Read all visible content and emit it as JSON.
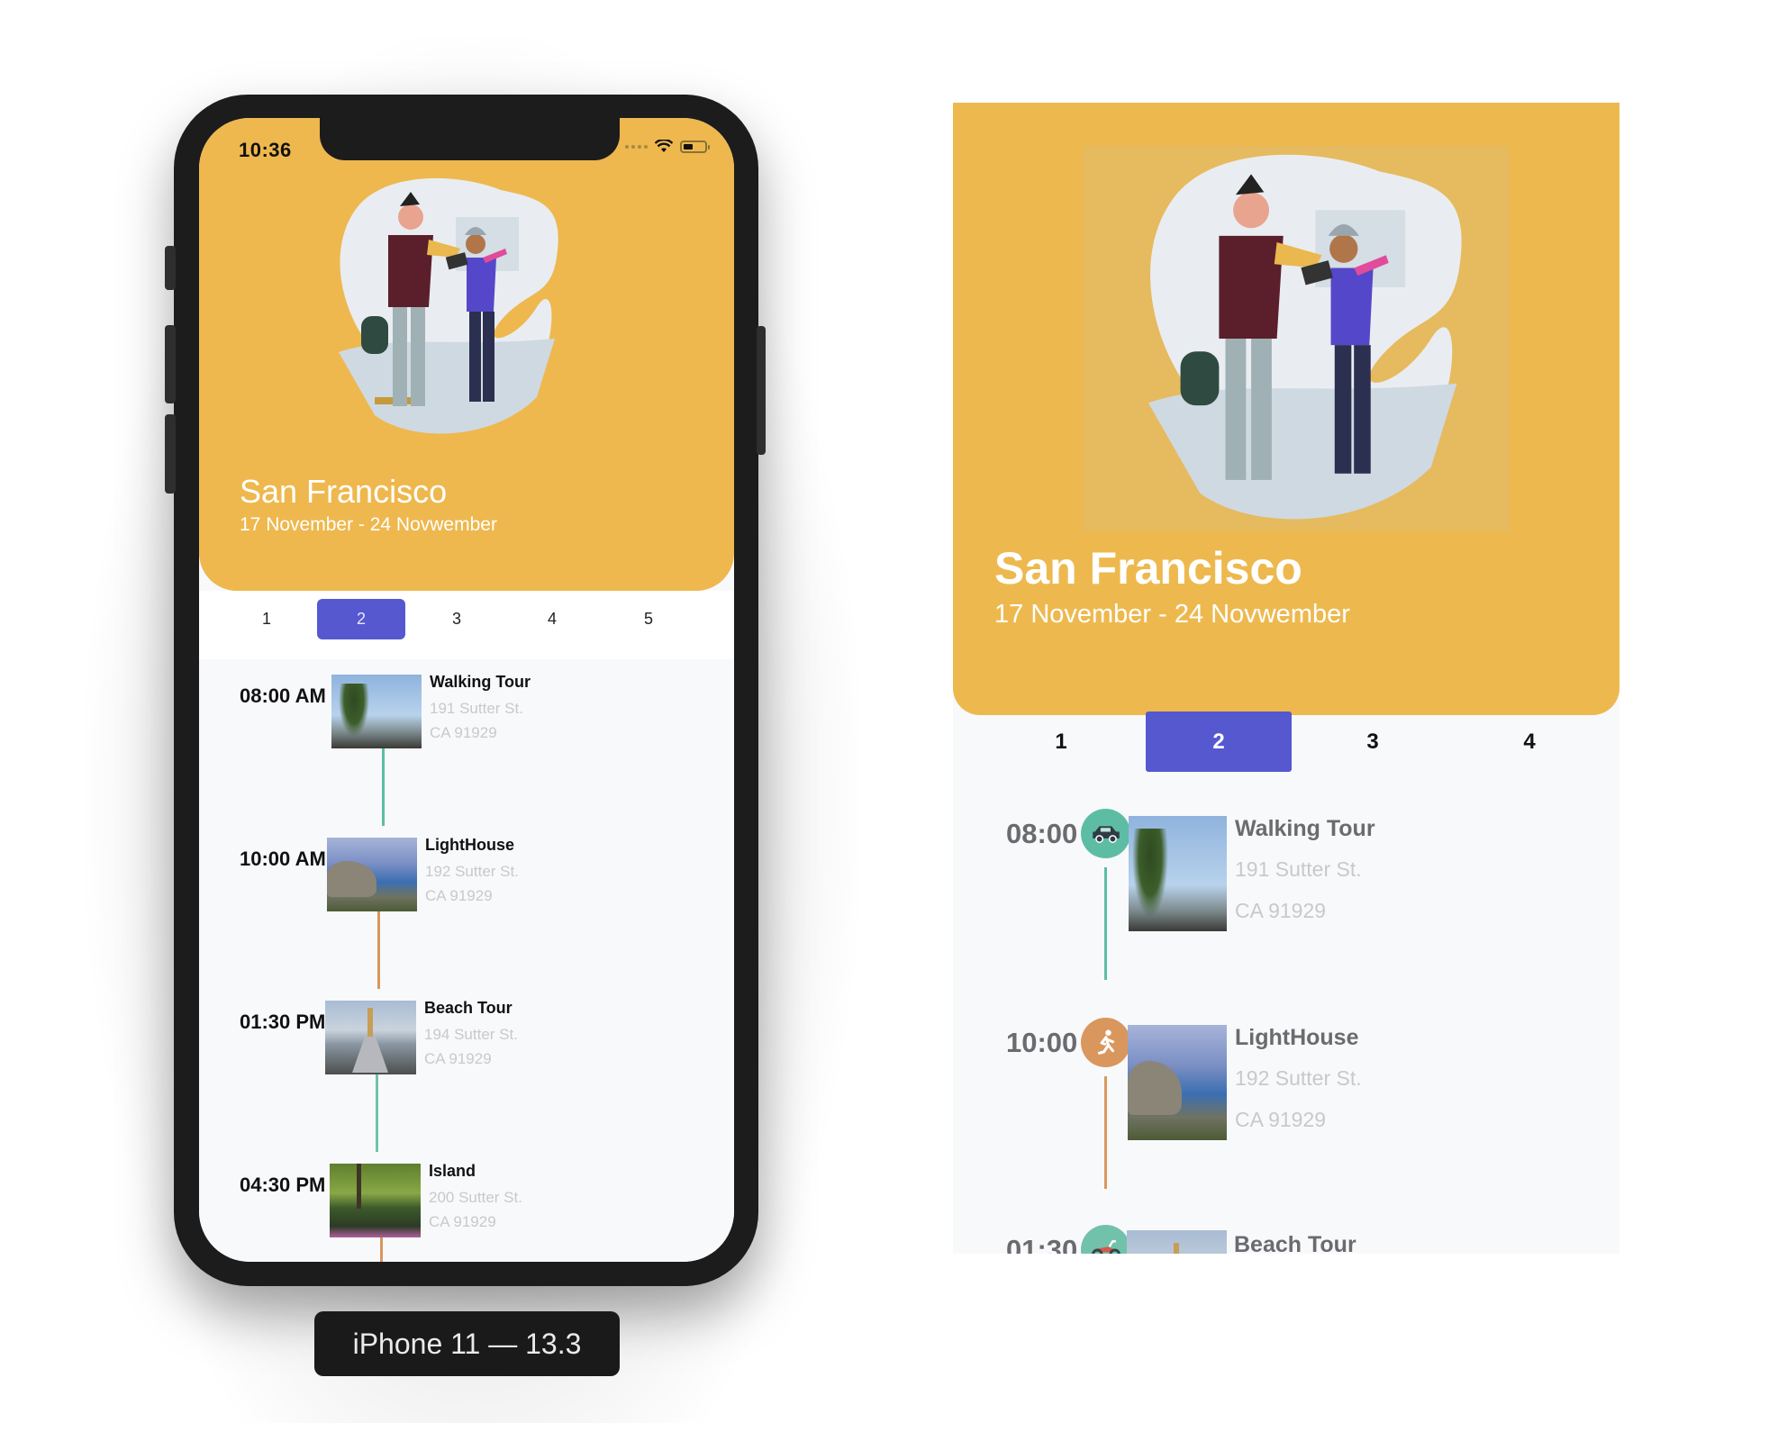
{
  "device_label": "iPhone 11 — 13.3",
  "status_bar": {
    "time": "10:36",
    "wifi_icon": "wifi-icon",
    "battery_icon": "battery-icon"
  },
  "colors": {
    "header": "#eeb84e",
    "accent": "#5558cf",
    "teal": "#5dbda4",
    "orange": "#d9975e",
    "list_bg": "#f8f9fb"
  },
  "trip": {
    "city": "San Francisco",
    "dates": "17 November - 24 Novwember"
  },
  "phone_tabs": [
    {
      "label": "1",
      "active": false
    },
    {
      "label": "2",
      "active": true
    },
    {
      "label": "3",
      "active": false
    },
    {
      "label": "4",
      "active": false
    },
    {
      "label": "5",
      "active": false
    }
  ],
  "preview_tabs": [
    {
      "label": "1",
      "active": false
    },
    {
      "label": "2",
      "active": true
    },
    {
      "label": "3",
      "active": false
    },
    {
      "label": "4",
      "active": false
    }
  ],
  "itinerary": [
    {
      "time": "08:00 AM",
      "icon": "car-icon",
      "color": "teal",
      "title": "Walking Tour",
      "address_line1": "191 Sutter St.",
      "address_line2": "CA 91929",
      "photo": "palm-beach-photo"
    },
    {
      "time": "10:00 AM",
      "icon": "walking-person-icon",
      "color": "orange",
      "title": "LightHouse",
      "address_line1": "192 Sutter St.",
      "address_line2": "CA 91929",
      "photo": "coastal-cliff-photo"
    },
    {
      "time": "01:30 PM",
      "icon": "motorcycle-icon",
      "color": "teal",
      "title": "Beach Tour",
      "address_line1": "194 Sutter St.",
      "address_line2": "CA 91929",
      "photo": "lighthouse-pier-photo"
    },
    {
      "time": "04:30 PM",
      "icon": "walking-person-icon",
      "color": "orange",
      "title": "Island",
      "address_line1": "200 Sutter St.",
      "address_line2": "CA 91929",
      "photo": "park-pond-photo"
    }
  ]
}
